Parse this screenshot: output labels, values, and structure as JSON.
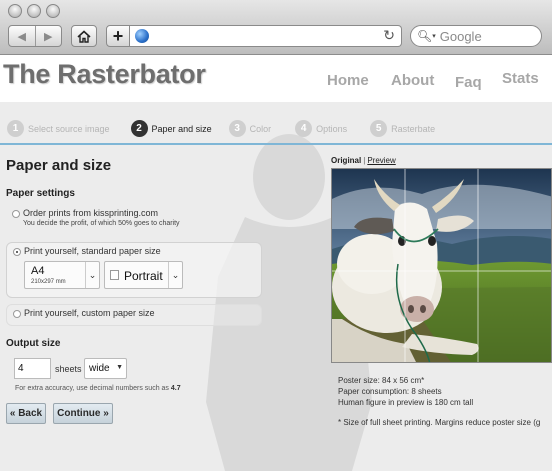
{
  "browser": {
    "search_placeholder": "Google",
    "icons": [
      "back-icon",
      "forward-icon",
      "home-icon",
      "add-tab-icon",
      "globe-icon",
      "reload-icon",
      "search-icon"
    ]
  },
  "site": {
    "logo": "The Rasterbator",
    "nav": [
      "Home",
      "About",
      "Faq",
      "Stats"
    ]
  },
  "steps": [
    {
      "num": "1",
      "label": "Select source image"
    },
    {
      "num": "2",
      "label": "Paper and size"
    },
    {
      "num": "3",
      "label": "Color"
    },
    {
      "num": "4",
      "label": "Options"
    },
    {
      "num": "5",
      "label": "Rasterbate"
    }
  ],
  "active_step": 2,
  "form": {
    "title": "Paper and size",
    "paper_settings_label": "Paper settings",
    "options": [
      {
        "title": "Order prints from kissprinting.com",
        "subtitle": "You decide the profit, of which 50% goes to charity",
        "checked": false
      },
      {
        "title": "Print yourself, standard paper size",
        "checked": true
      },
      {
        "title": "Print yourself, custom paper size",
        "checked": false
      }
    ],
    "paper_size": {
      "value": "A4",
      "sub": "210x297 mm"
    },
    "orientation": {
      "value": "Portrait"
    },
    "output_size_label": "Output size",
    "sheets_value": "4",
    "sheets_label": "sheets",
    "dimension_value": "wide",
    "hint_prefix": "For extra accuracy, use decimal numbers such as ",
    "hint_example": "4.7",
    "back_label": "« Back",
    "continue_label": "Continue »"
  },
  "preview": {
    "original_label": "Original",
    "separator": "|",
    "preview_label": "Preview",
    "poster_size": "Poster size: 84 x 56 cm*",
    "paper_consumption": "Paper consumption: 8 sheets",
    "human_figure": "Human figure in preview is 180 cm tall",
    "footnote": "* Size of full sheet printing. Margins reduce poster size (g"
  },
  "colors": {
    "accent_line": "#7fb6d6",
    "active_step": "#333333",
    "inactive_step": "#cfcfcf",
    "page_bg": "#ececec"
  }
}
